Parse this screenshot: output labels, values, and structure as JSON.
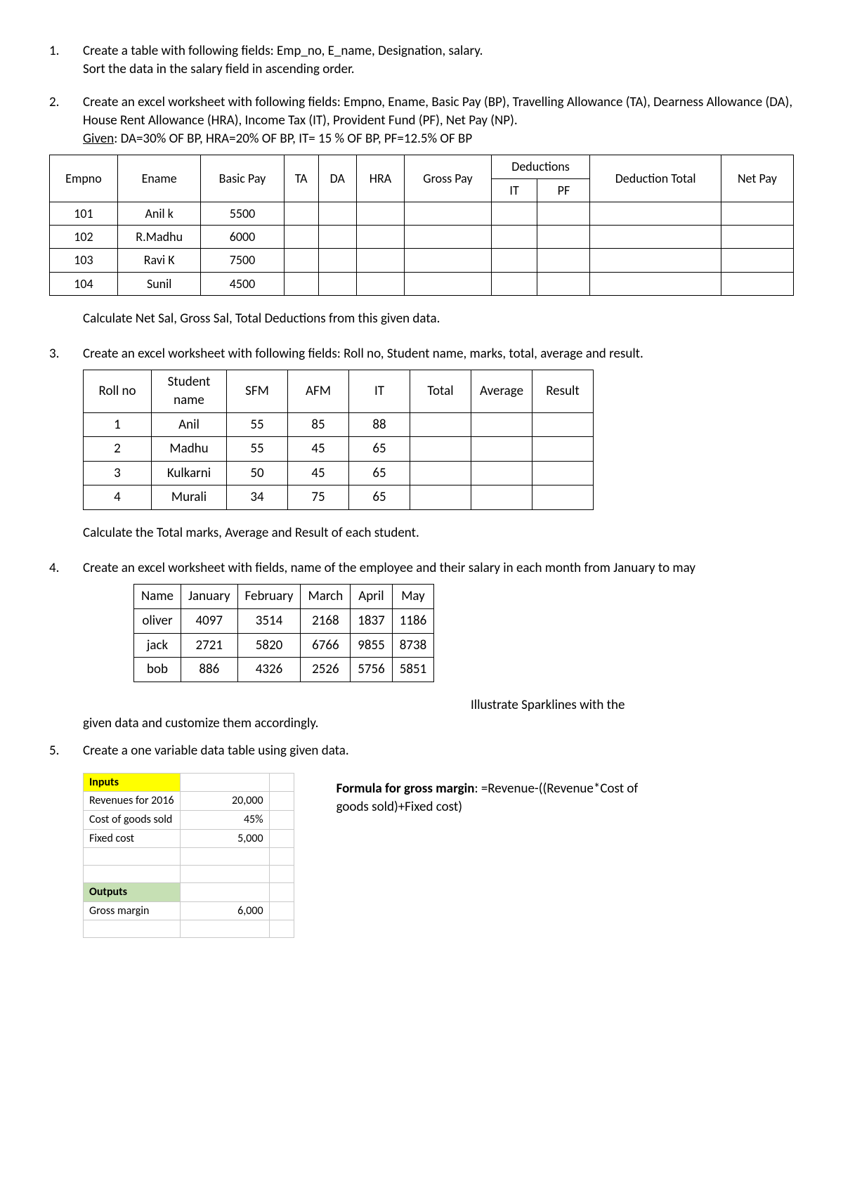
{
  "q1": {
    "num": "1.",
    "line1": "Create a table with following fields: Emp_no, E_name, Designation, salary.",
    "line2": "Sort the data in the salary field in ascending order."
  },
  "q2": {
    "num": "2.",
    "line1": "Create an excel worksheet with following fields: Empno, Ename, Basic Pay (BP), Travelling Allowance (TA), Dearness Allowance (DA), House Rent Allowance (HRA), Income Tax (IT), Provident Fund (PF), Net Pay (NP).",
    "given_label": "Given",
    "given_rest": ":  DA=30% OF BP, HRA=20% OF BP, IT= 15 % OF BP, PF=12.5% OF BP",
    "headers": {
      "empno": "Empno",
      "ename": "Ename",
      "bp": "Basic Pay",
      "ta": "TA",
      "da": "DA",
      "hra": "HRA",
      "gross": "Gross Pay",
      "ded": "Deductions",
      "it": "IT",
      "pf": "PF",
      "dedtot": "Deduction Total",
      "net": "Net Pay"
    },
    "rows": [
      {
        "empno": "101",
        "ename": "Anil k",
        "bp": "5500"
      },
      {
        "empno": "102",
        "ename": "R.Madhu",
        "bp": "6000"
      },
      {
        "empno": "103",
        "ename": "Ravi K",
        "bp": "7500"
      },
      {
        "empno": "104",
        "ename": "Sunil",
        "bp": "4500"
      }
    ],
    "after": "Calculate Net Sal, Gross Sal, Total Deductions from this given data."
  },
  "q3": {
    "num": "3.",
    "line1": "Create an excel worksheet with following fields: Roll no, Student name, marks, total, average and result.",
    "headers": {
      "roll": "Roll no",
      "name": "Student name",
      "sfm": "SFM",
      "afm": "AFM",
      "it": "IT",
      "total": "Total",
      "avg": "Average",
      "res": "Result"
    },
    "rows": [
      {
        "roll": "1",
        "name": "Anil",
        "sfm": "55",
        "afm": "85",
        "it": "88"
      },
      {
        "roll": "2",
        "name": "Madhu",
        "sfm": "55",
        "afm": "45",
        "it": "65"
      },
      {
        "roll": "3",
        "name": "Kulkarni",
        "sfm": "50",
        "afm": "45",
        "it": "65"
      },
      {
        "roll": "4",
        "name": "Murali",
        "sfm": "34",
        "afm": "75",
        "it": "65"
      }
    ],
    "after": "Calculate the Total marks, Average and Result of each student."
  },
  "q4": {
    "num": "4.",
    "line1": "Create an excel worksheet with fields, name of the employee and their salary in each month from January to may",
    "headers": {
      "name": "Name",
      "jan": "January",
      "feb": "February",
      "mar": "March",
      "apr": "April",
      "may": "May"
    },
    "rows": [
      {
        "name": "oliver",
        "jan": "4097",
        "feb": "3514",
        "mar": "2168",
        "apr": "1837",
        "may": "1186"
      },
      {
        "name": "jack",
        "jan": "2721",
        "feb": "5820",
        "mar": "6766",
        "apr": "9855",
        "may": "8738"
      },
      {
        "name": "bob",
        "jan": "886",
        "feb": "4326",
        "mar": "2526",
        "apr": "5756",
        "may": "5851"
      }
    ],
    "trail1": "Illustrate Sparklines with the",
    "trail2": "given data and customize them accordingly."
  },
  "q5": {
    "num": "5.",
    "line1": "Create a one variable data table using given data.",
    "excel_rows": [
      {
        "a": "Inputs",
        "b": "",
        "a_cls": "hdr-inputs"
      },
      {
        "a": "Revenues for 2016",
        "b": "20,000"
      },
      {
        "a": "Cost of goods sold",
        "b": "45%"
      },
      {
        "a": "Fixed cost",
        "b": "5,000"
      },
      {
        "a": "",
        "b": ""
      },
      {
        "a": "",
        "b": ""
      },
      {
        "a": "Outputs",
        "b": "",
        "a_cls": "hdr-outputs"
      },
      {
        "a": "Gross margin",
        "b": "6,000"
      },
      {
        "a": "",
        "b": ""
      }
    ],
    "formula_label": "Formula for gross margin",
    "formula_body": ": =Revenue-((Revenue*Cost of goods sold)+Fixed cost)"
  }
}
